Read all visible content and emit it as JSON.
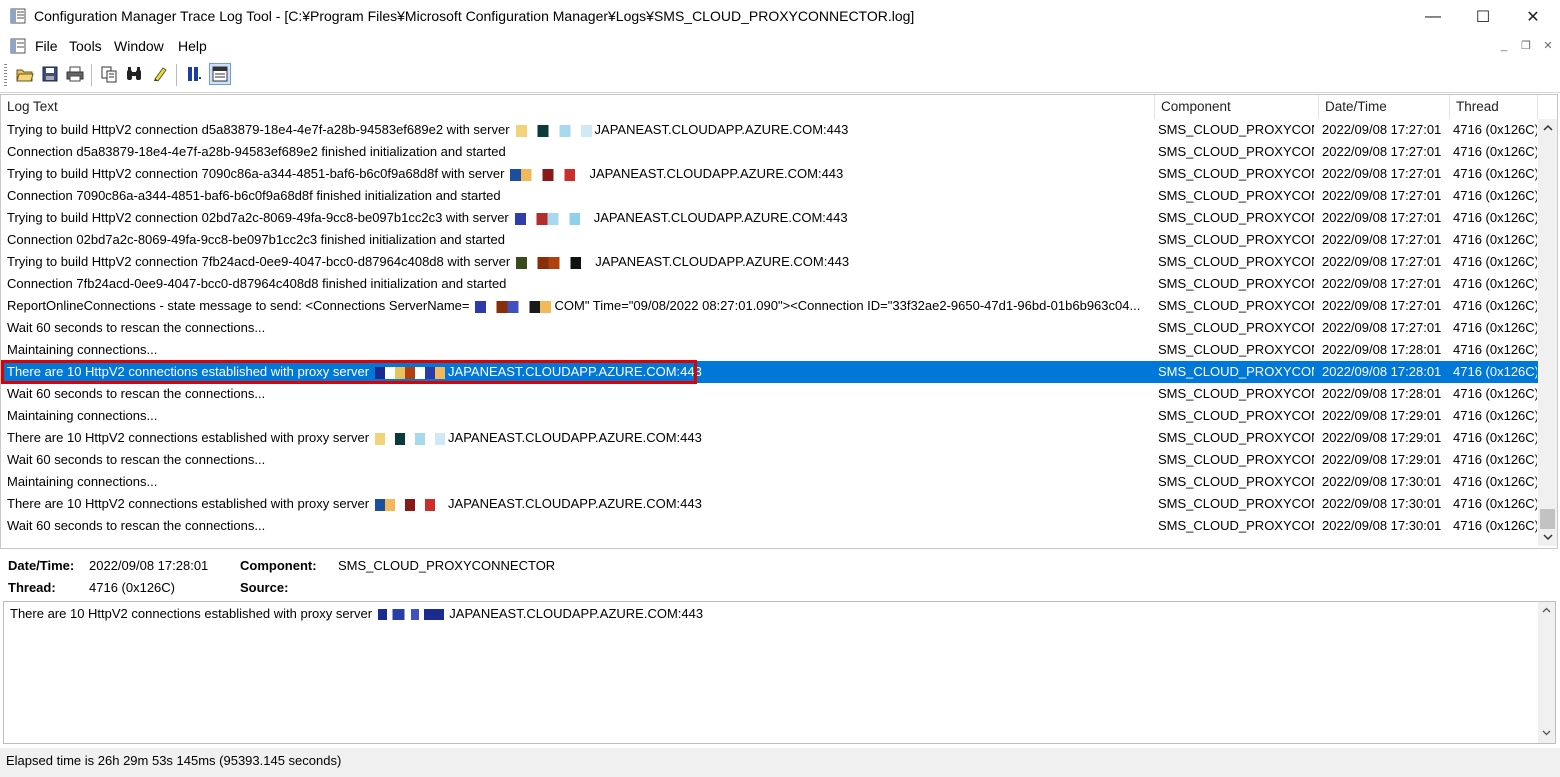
{
  "window": {
    "title": "Configuration Manager Trace Log Tool - [C:¥Program Files¥Microsoft Configuration Manager¥Logs¥SMS_CLOUD_PROXYCONNECTOR.log]",
    "minimize": "—",
    "maximize": "☐",
    "close": "✕"
  },
  "menu": {
    "items": [
      "File",
      "Tools",
      "Window",
      "Help"
    ],
    "mdi_minimize": "_",
    "mdi_restore": "❐",
    "mdi_close": "✕"
  },
  "toolbar": {
    "buttons": [
      "open-icon",
      "save-icon",
      "print-icon",
      "copy-icon",
      "find-icon",
      "highlight-icon",
      "pause-icon",
      "filter-icon"
    ]
  },
  "list": {
    "columns": [
      "Log Text",
      "Component",
      "Date/Time",
      "Thread"
    ],
    "rows": [
      {
        "text": "Trying to build HttpV2 connection d5a83879-18e4-4e7f-a28b-94583ef689e2 with server",
        "tail": "JAPANEAST.CLOUDAPP.AZURE.COM:443",
        "component": "SMS_CLOUD_PROXYCONNI",
        "datetime": "2022/09/08 17:27:01",
        "thread": "4716 (0x126C)"
      },
      {
        "text": "Connection d5a83879-18e4-4e7f-a28b-94583ef689e2 finished initialization and started",
        "tail": "",
        "component": "SMS_CLOUD_PROXYCONNI",
        "datetime": "2022/09/08 17:27:01",
        "thread": "4716 (0x126C)"
      },
      {
        "text": "Trying to build HttpV2 connection 7090c86a-a344-4851-baf6-b6c0f9a68d8f with server",
        "tail": "JAPANEAST.CLOUDAPP.AZURE.COM:443",
        "component": "SMS_CLOUD_PROXYCONNI",
        "datetime": "2022/09/08 17:27:01",
        "thread": "4716 (0x126C)"
      },
      {
        "text": "Connection 7090c86a-a344-4851-baf6-b6c0f9a68d8f finished initialization and started",
        "tail": "",
        "component": "SMS_CLOUD_PROXYCONNI",
        "datetime": "2022/09/08 17:27:01",
        "thread": "4716 (0x126C)"
      },
      {
        "text": "Trying to build HttpV2 connection 02bd7a2c-8069-49fa-9cc8-be097b1cc2c3 with server",
        "tail": "JAPANEAST.CLOUDAPP.AZURE.COM:443",
        "component": "SMS_CLOUD_PROXYCONNI",
        "datetime": "2022/09/08 17:27:01",
        "thread": "4716 (0x126C)"
      },
      {
        "text": "Connection 02bd7a2c-8069-49fa-9cc8-be097b1cc2c3 finished initialization and started",
        "tail": "",
        "component": "SMS_CLOUD_PROXYCONNI",
        "datetime": "2022/09/08 17:27:01",
        "thread": "4716 (0x126C)"
      },
      {
        "text": "Trying to build HttpV2 connection 7fb24acd-0ee9-4047-bcc0-d87964c408d8 with server",
        "tail": "JAPANEAST.CLOUDAPP.AZURE.COM:443",
        "component": "SMS_CLOUD_PROXYCONNI",
        "datetime": "2022/09/08 17:27:01",
        "thread": "4716 (0x126C)"
      },
      {
        "text": "Connection 7fb24acd-0ee9-4047-bcc0-d87964c408d8 finished initialization and started",
        "tail": "",
        "component": "SMS_CLOUD_PROXYCONNI",
        "datetime": "2022/09/08 17:27:01",
        "thread": "4716 (0x126C)"
      },
      {
        "text": "ReportOnlineConnections - state message to send: <Connections ServerName=",
        "tail": "COM\" Time=\"09/08/2022 08:27:01.090\"><Connection ID=\"33f32ae2-9650-47d1-96bd-01b6b963c04...",
        "component": "SMS_CLOUD_PROXYCONNI",
        "datetime": "2022/09/08 17:27:01",
        "thread": "4716 (0x126C)"
      },
      {
        "text": "Wait 60 seconds to rescan the connections...",
        "tail": "",
        "component": "SMS_CLOUD_PROXYCONNI",
        "datetime": "2022/09/08 17:27:01",
        "thread": "4716 (0x126C)"
      },
      {
        "text": "Maintaining connections...",
        "tail": "",
        "component": "SMS_CLOUD_PROXYCONNI",
        "datetime": "2022/09/08 17:28:01",
        "thread": "4716 (0x126C)"
      },
      {
        "text": "There are 10 HttpV2 connections established with proxy server",
        "tail": "JAPANEAST.CLOUDAPP.AZURE.COM:443",
        "component": "SMS_CLOUD_PROXYCONNI",
        "datetime": "2022/09/08 17:28:01",
        "thread": "4716 (0x126C)",
        "selected": true
      },
      {
        "text": "Wait 60 seconds to rescan the connections...",
        "tail": "",
        "component": "SMS_CLOUD_PROXYCONNI",
        "datetime": "2022/09/08 17:28:01",
        "thread": "4716 (0x126C)"
      },
      {
        "text": "Maintaining connections...",
        "tail": "",
        "component": "SMS_CLOUD_PROXYCONNI",
        "datetime": "2022/09/08 17:29:01",
        "thread": "4716 (0x126C)"
      },
      {
        "text": "There are 10 HttpV2 connections established with proxy server",
        "tail": "JAPANEAST.CLOUDAPP.AZURE.COM:443",
        "component": "SMS_CLOUD_PROXYCONNI",
        "datetime": "2022/09/08 17:29:01",
        "thread": "4716 (0x126C)"
      },
      {
        "text": "Wait 60 seconds to rescan the connections...",
        "tail": "",
        "component": "SMS_CLOUD_PROXYCONNI",
        "datetime": "2022/09/08 17:29:01",
        "thread": "4716 (0x126C)"
      },
      {
        "text": "Maintaining connections...",
        "tail": "",
        "component": "SMS_CLOUD_PROXYCONNI",
        "datetime": "2022/09/08 17:30:01",
        "thread": "4716 (0x126C)"
      },
      {
        "text": "There are 10 HttpV2 connections established with proxy server",
        "tail": "JAPANEAST.CLOUDAPP.AZURE.COM:443",
        "component": "SMS_CLOUD_PROXYCONNI",
        "datetime": "2022/09/08 17:30:01",
        "thread": "4716 (0x126C)"
      },
      {
        "text": "Wait 60 seconds to rescan the connections...",
        "tail": "",
        "component": "SMS_CLOUD_PROXYCONNI",
        "datetime": "2022/09/08 17:30:01",
        "thread": "4716 (0x126C)"
      }
    ]
  },
  "details": {
    "datetime_label": "Date/Time:",
    "datetime_value": "2022/09/08 17:28:01",
    "component_label": "Component:",
    "component_value": "SMS_CLOUD_PROXYCONNECTOR",
    "thread_label": "Thread:",
    "thread_value": "4716 (0x126C)",
    "source_label": "Source:",
    "source_value": "",
    "message_prefix": "There are 10 HttpV2 connections established with proxy server",
    "message_suffix": "JAPANEAST.CLOUDAPP.AZURE.COM:443"
  },
  "status": {
    "text": "Elapsed time is 26h 29m 53s 145ms (95393.145 seconds)"
  },
  "colors": {
    "selection": "#0078d7",
    "highlight_box": "#e00000"
  }
}
